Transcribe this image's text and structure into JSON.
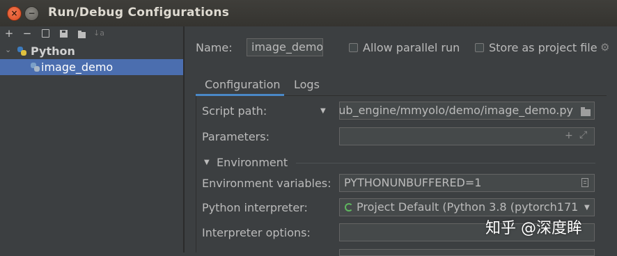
{
  "window": {
    "title": "Run/Debug Configurations"
  },
  "toolbar": {
    "add": "+",
    "remove": "−",
    "sort": "↓a"
  },
  "tree": {
    "group_label": "Python",
    "items": [
      {
        "label": "image_demo",
        "selected": true
      }
    ]
  },
  "config": {
    "name_label": "Name:",
    "name_value": "image_demo",
    "allow_parallel_label": "Allow parallel run",
    "allow_parallel_checked": false,
    "store_project_label": "Store as project file",
    "store_project_checked": false
  },
  "tabs": [
    {
      "label": "Configuration",
      "active": true
    },
    {
      "label": "Logs",
      "active": false
    }
  ],
  "fields": {
    "script_path_label": "Script path:",
    "script_path_value": "ub_engine/mmyolo/demo/image_demo.py",
    "parameters_label": "Parameters:",
    "parameters_value": "",
    "environment_section": "Environment",
    "env_vars_label": "Environment variables:",
    "env_vars_value": "PYTHONUNBUFFERED=1",
    "interpreter_label": "Python interpreter:",
    "interpreter_value": "Project Default (Python 3.8 (pytorch171",
    "interp_options_label": "Interpreter options:",
    "interp_options_value": ""
  },
  "watermark": "知乎 @深度眸",
  "colors": {
    "background": "#3c3f41",
    "selection": "#4b6eaf",
    "accent_tab": "#4a88c7",
    "text": "#bbbbbb"
  }
}
